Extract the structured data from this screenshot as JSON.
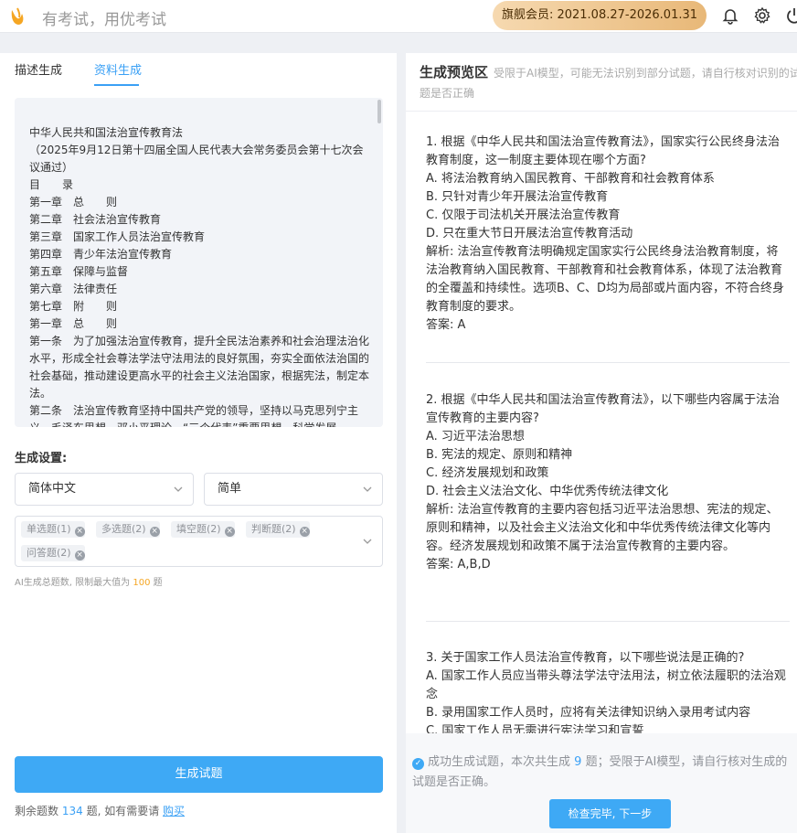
{
  "header": {
    "slogan": "有考试，用优考试",
    "membership": "旗舰会员:  2021.08.27-2026.01.31",
    "icons": [
      "bell-icon",
      "gear-icon",
      "power-icon"
    ],
    "brand_color": "#f5a623"
  },
  "left": {
    "tabs": [
      "描述生成",
      "资料生成"
    ],
    "active_tab": "资料生成",
    "source_text": "中华人民共和国法治宣传教育法\n（2025年9月12日第十四届全国人民代表大会常务委员会第十七次会议通过）\n目　　录\n第一章　总　　则\n第二章　社会法治宣传教育\n第三章　国家工作人员法治宣传教育\n第四章　青少年法治宣传教育\n第五章　保障与监督\n第六章　法律责任\n第七章　附　　则\n第一章　总　　则\n第一条　为了加强法治宣传教育，提升全民法治素养和社会治理法治化水平，形成全社会尊法学法守法用法的良好氛围，夯实全面依法治国的社会基础，推动建设更高水平的社会主义法治国家，根据宪法，制定本法。\n第二条　法治宣传教育坚持中国共产党的领导，坚持以马克思列宁主义、毛泽东思想、邓小平理论、“三个代表”重要思想、科学发展",
    "settings_title": "生成设置:",
    "language": "简体中文",
    "difficulty": "简单",
    "tags": [
      {
        "label": "单选题(1)"
      },
      {
        "label": "多选题(2)"
      },
      {
        "label": "填空题(2)"
      },
      {
        "label": "判断题(2)"
      },
      {
        "label": "问答题(2)"
      }
    ],
    "hint_prefix": "AI生成总题数, 限制最大值为",
    "hint_max": "100",
    "hint_suffix": "题",
    "generate_label": "生成试题",
    "remain_prefix": "剩余题数",
    "remain_count": "134",
    "remain_mid": "题, 如有需要请",
    "buy_label": "购买"
  },
  "preview": {
    "title": "生成预览区",
    "note": "受限于AI模型，可能无法识别到部分试题，请自行核对识别的试题是否正确",
    "questions": [
      {
        "stem": "1. 根据《中华人民共和国法治宣传教育法》，国家实行公民终身法治教育制度，这一制度主要体现在哪个方面?",
        "options": [
          "A. 将法治教育纳入国民教育、干部教育和社会教育体系",
          "B. 只针对青少年开展法治宣传教育",
          "C. 仅限于司法机关开展法治宣传教育",
          "D. 只在重大节日开展法治宣传教育活动"
        ],
        "analysis": "解析: 法治宣传教育法明确规定国家实行公民终身法治教育制度，将法治教育纳入国民教育、干部教育和社会教育体系，体现了法治教育的全覆盖和持续性。选项B、C、D均为局部或片面内容，不符合终身教育制度的要求。",
        "answer": "答案: A"
      },
      {
        "stem": "2. 根据《中华人民共和国法治宣传教育法》，以下哪些内容属于法治宣传教育的主要内容?",
        "options": [
          "A. 习近平法治思想",
          "B. 宪法的规定、原则和精神",
          "C. 经济发展规划和政策",
          "D. 社会主义法治文化、中华优秀传统法律文化"
        ],
        "analysis": "解析: 法治宣传教育的主要内容包括习近平法治思想、宪法的规定、原则和精神，以及社会主义法治文化和中华优秀传统法律文化等内容。经济发展规划和政策不属于法治宣传教育的主要内容。",
        "answer": "答案: A,B,D"
      },
      {
        "stem": "3. 关于国家工作人员法治宣传教育，以下哪些说法是正确的?",
        "options": [
          "A. 国家工作人员应当带头尊法学法守法用法，树立依法履职的法治观念",
          "B. 录用国家工作人员时，应将有关法律知识纳入录用考试内容",
          "C. 国家工作人员无需进行宪法学习和宣誓"
        ],
        "analysis": "",
        "answer": ""
      }
    ],
    "success_prefix": "成功生成试题，本次共生成",
    "success_count": "9",
    "success_suffix": "题；受限于AI模型，请自行核对生成的试题是否正确。",
    "next_label": "检查完毕, 下一步"
  }
}
